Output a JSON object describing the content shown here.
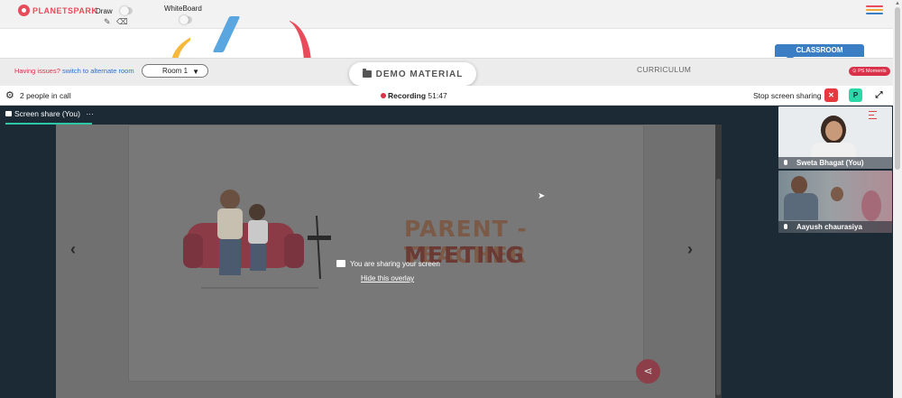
{
  "app": {
    "brand": "PLANETSPARK"
  },
  "toolbar": {
    "draw_label": "Draw",
    "whiteboard_label": "WhiteBoard",
    "draw_on": false,
    "whiteboard_on": false
  },
  "tabs": {
    "classroom": "CLASSROOM",
    "curriculum": "CURRICULUM",
    "demo_material": "DEMO MATERIAL",
    "moments": "PS Moments"
  },
  "room": {
    "issues_text": "Having issues?",
    "alternate_link": "switch to alternate room",
    "selected_room": "Room 1"
  },
  "call": {
    "people_count": "2 people in call",
    "recording_label": "Recording",
    "recording_time": "51:47",
    "stop_sharing": "Stop screen sharing",
    "p_button": "P"
  },
  "stage": {
    "tab_label": "Screen share (You)",
    "tab_more": "···",
    "slide_title_line1": "PARENT - TEACHER",
    "slide_title_line2": "MEETING",
    "overlay_message": "You are sharing your screen",
    "hide_overlay": "Hide this overlay"
  },
  "participants": [
    {
      "name": "Sweta Bhagat (You)"
    },
    {
      "name": "Aayush chaurasiya"
    }
  ],
  "colors": {
    "brand_red": "#e94b5b",
    "classroom_blue": "#3b7ec4",
    "stage_bg": "#1b2a35",
    "accent_green": "#2bc7a6",
    "stop_red": "#e5393f"
  }
}
